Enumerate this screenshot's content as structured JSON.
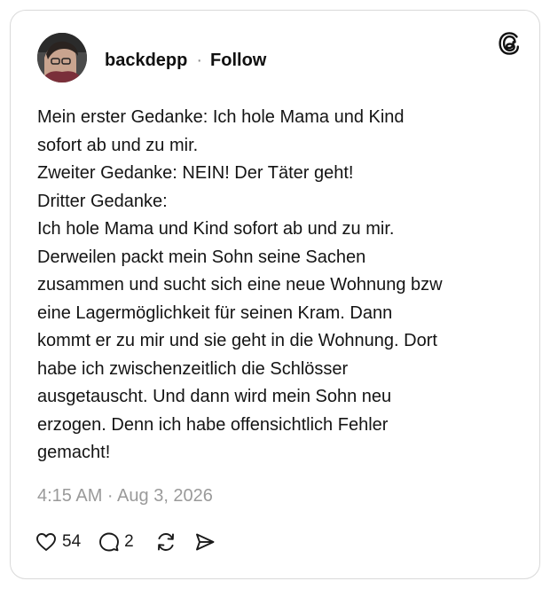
{
  "post": {
    "username": "backdepp",
    "separator": "·",
    "follow_label": "Follow",
    "text": "Mein erster Gedanke: Ich hole Mama und Kind\nsofort ab und zu mir.\nZweiter Gedanke: NEIN! Der Täter geht!\nDritter Gedanke:\nIch hole Mama und Kind sofort ab und zu mir.\nDerweilen packt mein Sohn seine Sachen\nzusammen und sucht sich eine neue Wohnung bzw\neine Lagermöglichkeit für seinen Kram. Dann\nkommt er zu mir und sie geht in die Wohnung. Dort\nhabe ich zwischenzeitlich die Schlösser\nausgetauscht. Und dann wird mein Sohn neu\nerzogen. Denn ich habe offensichtlich Fehler\ngemacht!",
    "timestamp": "4:15 AM · Aug 3, 2026"
  },
  "actions": {
    "like_count": "54",
    "reply_count": "2"
  },
  "icons": {
    "logo": "threads-logo-icon",
    "like": "heart-icon",
    "reply": "speech-bubble-icon",
    "repost": "repost-icon",
    "share": "send-icon"
  },
  "colors": {
    "text": "#141414",
    "muted": "#9a9a9a",
    "border": "#d9d9d9"
  }
}
